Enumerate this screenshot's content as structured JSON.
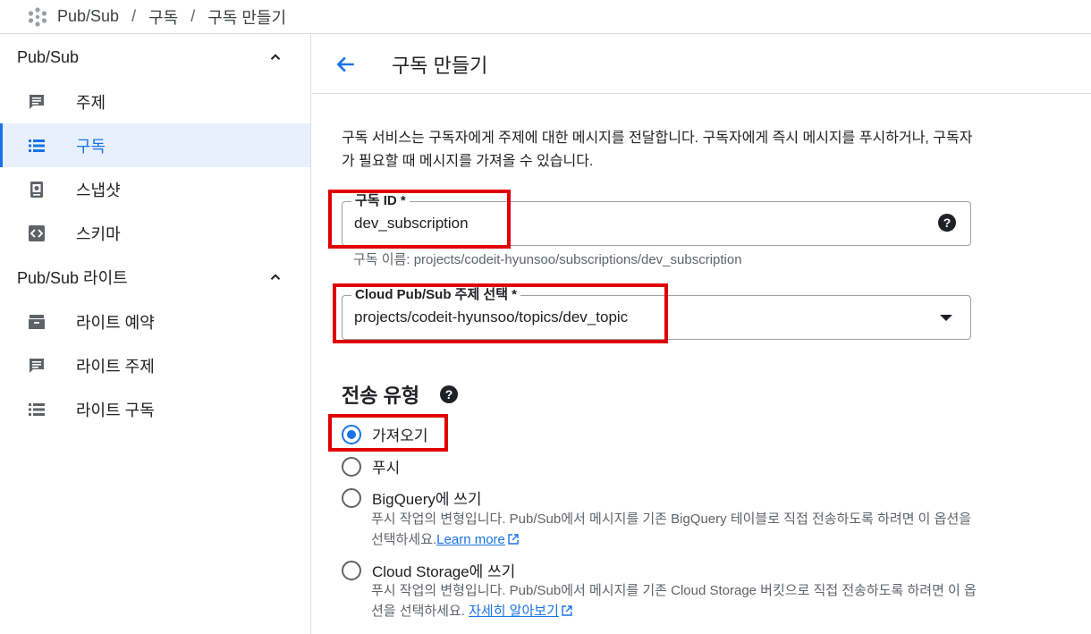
{
  "breadcrumb": {
    "items": [
      "Pub/Sub",
      "구독",
      "구독 만들기"
    ],
    "separator": "/"
  },
  "sidebar": {
    "sections": [
      {
        "title": "Pub/Sub",
        "items": [
          {
            "label": "주제",
            "icon": "message-icon"
          },
          {
            "label": "구독",
            "icon": "list-icon",
            "active": true
          },
          {
            "label": "스냅샷",
            "icon": "snapshot-icon"
          },
          {
            "label": "스키마",
            "icon": "schema-icon"
          }
        ]
      },
      {
        "title": "Pub/Sub 라이트",
        "items": [
          {
            "label": "라이트 예약",
            "icon": "reservation-icon"
          },
          {
            "label": "라이트 주제",
            "icon": "message-icon"
          },
          {
            "label": "라이트 구독",
            "icon": "list-icon"
          }
        ]
      }
    ]
  },
  "page": {
    "title": "구독 만들기",
    "description": "구독 서비스는 구독자에게 주제에 대한 메시지를 전달합니다. 구독자에게 즉시 메시지를 푸시하거나, 구독자가 필요할 때 메시지를 가져올 수 있습니다."
  },
  "form": {
    "subscription_id": {
      "label": "구독 ID *",
      "value": "dev_subscription",
      "hint": "구독 이름: projects/codeit-hyunsoo/subscriptions/dev_subscription"
    },
    "topic": {
      "label": "Cloud Pub/Sub 주제 선택 *",
      "value": "projects/codeit-hyunsoo/topics/dev_topic"
    },
    "delivery": {
      "title": "전송 유형",
      "options": [
        {
          "label": "가져오기",
          "selected": true
        },
        {
          "label": "푸시",
          "selected": false
        },
        {
          "label": "BigQuery에 쓰기",
          "selected": false,
          "description": "푸시 작업의 변형입니다. Pub/Sub에서 메시지를 기존 BigQuery 테이블로 직접 전송하도록 하려면 이 옵션을 선택하세요.",
          "link": "Learn more"
        },
        {
          "label": "Cloud Storage에 쓰기",
          "selected": false,
          "description": "푸시 작업의 변형입니다. Pub/Sub에서 메시지를 기존 Cloud Storage 버킷으로 직접 전송하도록 하려면 이 옵션을 선택하세요.",
          "link": "자세히 알아보기"
        }
      ]
    }
  },
  "colors": {
    "accent": "#1a73e8",
    "annotation": "#e00000",
    "active_bg": "#e8f0fe"
  }
}
